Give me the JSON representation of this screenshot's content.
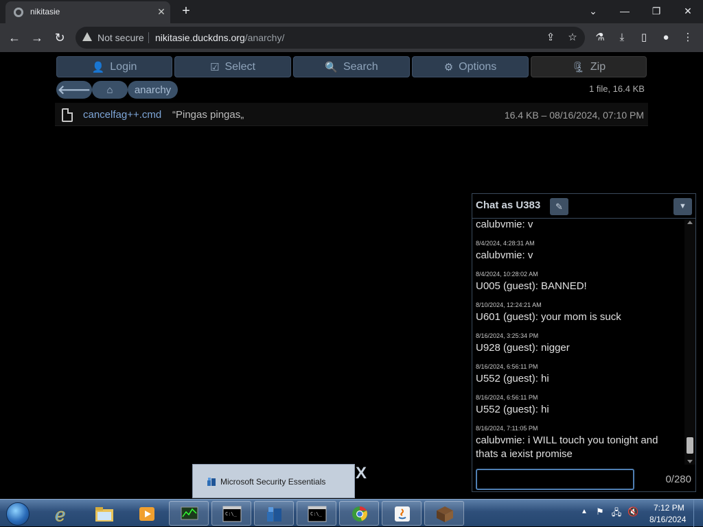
{
  "browser": {
    "tab_title": "nikitasie",
    "tab_close": "✕",
    "new_tab": "+",
    "window_controls": {
      "minimize": "—",
      "restore": "❐",
      "close": "✕",
      "dropdown": "⌄"
    },
    "nav": {
      "back": "←",
      "forward": "→",
      "reload": "↻"
    },
    "security_label": "Not secure",
    "url_host": "nikitasie.duckdns.org",
    "url_path": "/anarchy/",
    "toolbar_icons": [
      "share-icon",
      "star-icon",
      "labs-icon",
      "download-icon",
      "sidepanel-icon",
      "profile-icon",
      "menu-icon"
    ]
  },
  "toolbar": {
    "login_label": "Login",
    "select_label": "Select",
    "search_label": "Search",
    "options_label": "Options",
    "zip_label": "Zip"
  },
  "breadcrumb": {
    "folder": "anarchy"
  },
  "listing": {
    "summary": "1 file, 16.4 KB",
    "files": [
      {
        "name": "cancelfag++.cmd",
        "description": "“Pingas pingas„",
        "meta": "16.4 KB – 08/16/2024, 07:10 PM"
      }
    ]
  },
  "chat": {
    "title": "Chat as U383",
    "edit_icon": "✎",
    "collapse_icon": "▼",
    "first_partial": "calubvmie: v",
    "messages": [
      {
        "ts": "8/4/2024, 4:28:31 AM",
        "text": "calubvmie: v"
      },
      {
        "ts": "8/4/2024, 10:28:02 AM",
        "text": "U005 (guest): BANNED!"
      },
      {
        "ts": "8/10/2024, 12:24:21 AM",
        "text": "U601 (guest): your mom is suck"
      },
      {
        "ts": "8/16/2024, 3:25:34 PM",
        "text": "U928 (guest): nigger"
      },
      {
        "ts": "8/16/2024, 6:56:11 PM",
        "text": "U552 (guest): hi"
      },
      {
        "ts": "8/16/2024, 6:56:11 PM",
        "text": "U552 (guest): hi"
      },
      {
        "ts": "8/16/2024, 7:11:05 PM",
        "text": "calubvmie: i WILL touch you tonight and thats a iexist promise"
      }
    ],
    "input_value": "",
    "counter": "0/280"
  },
  "notification": {
    "label": "Microsoft Security Essentials",
    "close": "X"
  },
  "taskbar": {
    "items": [
      "internet-explorer-icon",
      "explorer-icon",
      "media-player-icon",
      "task-manager-icon",
      "cmd-icon",
      "security-essentials-icon",
      "cmd-icon",
      "chrome-icon",
      "java-icon",
      "minecraft-icon"
    ],
    "clock_time": "7:12 PM",
    "clock_date": "8/16/2024"
  },
  "colors": {
    "accent_button": "#2d3d50",
    "link": "#7ea6d8",
    "chat_border": "#3a4a5c",
    "input_focus": "#4f7fb3"
  }
}
